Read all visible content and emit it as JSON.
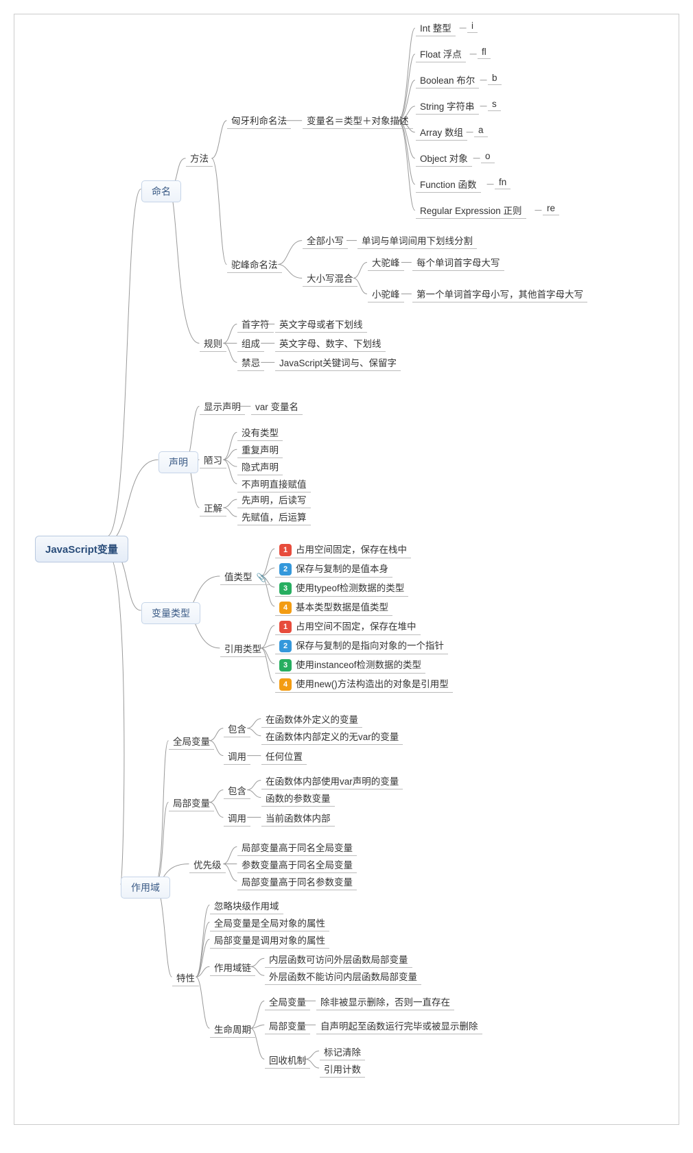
{
  "root": "JavaScript变量",
  "b1": "命名",
  "b2": "声明",
  "b3": "变量类型",
  "b4": "作用域",
  "b1_method": "方法",
  "b1_rule": "规则",
  "hun": "匈牙利命名法",
  "hun_desc": "变量名＝类型＋对象描述",
  "hun_int": "Int 整型",
  "hun_int_s": "i",
  "hun_float": "Float 浮点",
  "hun_float_s": "fl",
  "hun_bool": "Boolean 布尔",
  "hun_bool_s": "b",
  "hun_str": "String 字符串",
  "hun_str_s": "s",
  "hun_arr": "Array 数组",
  "hun_arr_s": "a",
  "hun_obj": "Object 对象",
  "hun_obj_s": "o",
  "hun_fn": "Function 函数",
  "hun_fn_s": "fn",
  "hun_re": "Regular Expression 正则",
  "hun_re_s": "re",
  "camel": "驼峰命名法",
  "camel_lower": "全部小写",
  "camel_lower_desc": "单词与单词间用下划线分割",
  "camel_mix": "大小写混合",
  "camel_big": "大驼峰",
  "camel_big_desc": "每个单词首字母大写",
  "camel_small": "小驼峰",
  "camel_small_desc": "第一个单词首字母小写，其他首字母大写",
  "rule_first": "首字符",
  "rule_first_desc": "英文字母或者下划线",
  "rule_comp": "组成",
  "rule_comp_desc": "英文字母、数字、下划线",
  "rule_ban": "禁忌",
  "rule_ban_desc": "JavaScript关键词与、保留字",
  "decl_show": "显示声明",
  "decl_show_desc": "var 变量名",
  "decl_bad": "陋习",
  "decl_bad_1": "没有类型",
  "decl_bad_2": "重复声明",
  "decl_bad_3": "隐式声明",
  "decl_bad_4": "不声明直接赋值",
  "decl_good": "正解",
  "decl_good_1": "先声明，后读写",
  "decl_good_2": "先赋值，后运算",
  "type_val": "值类型",
  "type_val_1": "占用空间固定，保存在栈中",
  "type_val_2": "保存与复制的是值本身",
  "type_val_3": "使用typeof检测数据的类型",
  "type_val_4": "基本类型数据是值类型",
  "type_ref": "引用类型",
  "type_ref_1": "占用空间不固定，保存在堆中",
  "type_ref_2": "保存与复制的是指向对象的一个指针",
  "type_ref_3": "使用instanceof检测数据的类型",
  "type_ref_4": "使用new()方法构造出的对象是引用型",
  "scope_global": "全局变量",
  "scope_global_inc": "包含",
  "scope_global_inc_1": "在函数体外定义的变量",
  "scope_global_inc_2": "在函数体内部定义的无var的变量",
  "scope_global_call": "调用",
  "scope_global_call_1": "任何位置",
  "scope_local": "局部变量",
  "scope_local_inc": "包含",
  "scope_local_inc_1": "在函数体内部使用var声明的变量",
  "scope_local_inc_2": "函数的参数变量",
  "scope_local_call": "调用",
  "scope_local_call_1": "当前函数体内部",
  "scope_prio": "优先级",
  "scope_prio_1": "局部变量高于同名全局变量",
  "scope_prio_2": "参数变量高于同名全局变量",
  "scope_prio_3": "局部变量高于同名参数变量",
  "scope_feat": "特性",
  "scope_feat_1": "忽略块级作用域",
  "scope_feat_2": "全局变量是全局对象的属性",
  "scope_feat_3": "局部变量是调用对象的属性",
  "scope_chain": "作用域链",
  "scope_chain_1": "内层函数可访问外层函数局部变量",
  "scope_chain_2": "外层函数不能访问内层函数局部变量",
  "scope_life": "生命周期",
  "scope_life_global": "全局变量",
  "scope_life_global_desc": "除非被显示删除，否则一直存在",
  "scope_life_local": "局部变量",
  "scope_life_local_desc": "自声明起至函数运行完毕或被显示删除",
  "scope_gc": "回收机制",
  "scope_gc_1": "标记清除",
  "scope_gc_2": "引用计数"
}
